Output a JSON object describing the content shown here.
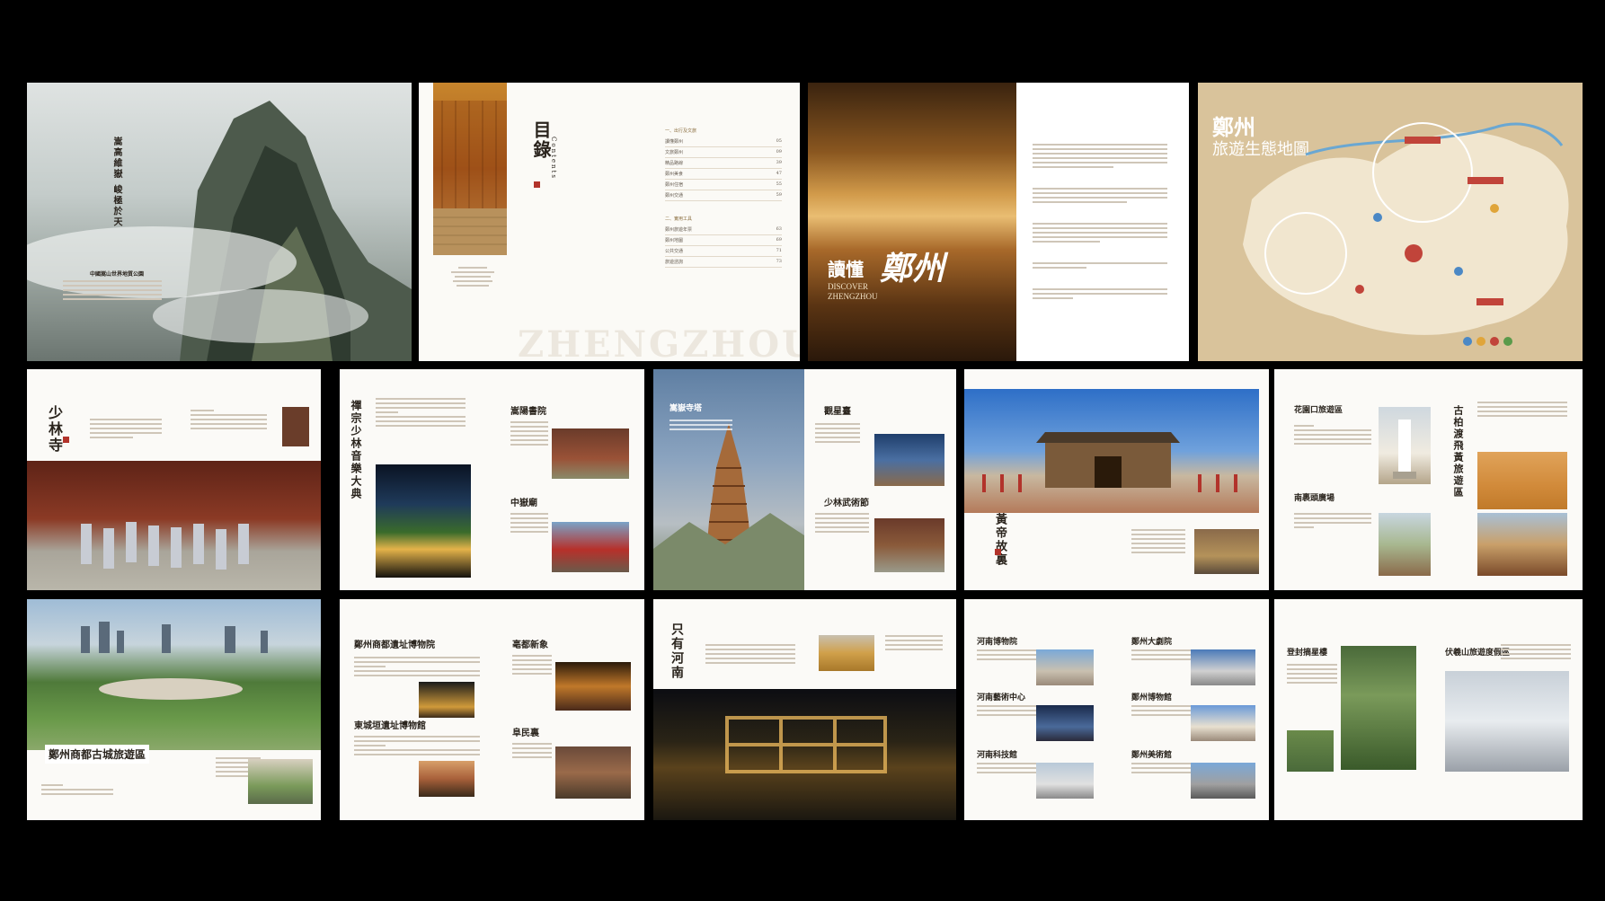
{
  "spread1": {
    "poem": "嵩高維嶽 峻極於天",
    "caption": "中國嵩山世界地質公園"
  },
  "spread2": {
    "title": "目錄",
    "subtitle": "Contents",
    "section1": "一、出行及文旅",
    "section2": "二、實用工具",
    "toc_items": [
      "讀懂鄭州",
      "文旅鄭州",
      "精品路線",
      "鄭州美食",
      "鄭州住宿",
      "鄭州交通"
    ],
    "toc_items2": [
      "鄭州旅遊年票",
      "鄭州地圖",
      "公共交通",
      "旅遊諮詢"
    ],
    "watermark": "ZHENGZHOU"
  },
  "spread3": {
    "title": "讀懂",
    "title_big": "鄭州",
    "en": "DISCOVER",
    "en2": "ZHENGZHOU"
  },
  "spread4": {
    "title": "鄭州",
    "title2": "旅遊生態地圖"
  },
  "spread5": {
    "title": "少林寺"
  },
  "spread6": {
    "title1": "禪宗少林音樂大典",
    "title2": "嵩陽書院",
    "title3": "中嶽廟"
  },
  "spread7": {
    "title1": "嵩嶽寺塔",
    "title2": "觀星臺",
    "title3": "少林武術節"
  },
  "spread8": {
    "title": "黃帝故裏"
  },
  "spread9": {
    "title1": "花園口旅遊區",
    "title2": "南裹頭廣場",
    "title3": "古柏渡飛黃旅遊區"
  },
  "spread10": {
    "title": "鄭州商都古城旅遊區"
  },
  "spread11": {
    "title1": "鄭州商都遺址博物院",
    "title2": "亳都新象",
    "title3": "東城垣遺址博物館",
    "title4": "阜民裏"
  },
  "spread12": {
    "title": "只有河南"
  },
  "spread13": {
    "titles": [
      "河南博物院",
      "河南藝術中心",
      "河南科技館",
      "鄭州大劇院",
      "鄭州博物館",
      "鄭州美術館"
    ]
  },
  "spread14": {
    "title1": "登封摘星樓",
    "title2": "伏羲山旅遊度假區"
  },
  "colors": {
    "background": "#000000",
    "paper": "#fbfaf7",
    "gold": "#c9a56a",
    "seal_red": "#b2332b",
    "text": "#2a241d"
  }
}
